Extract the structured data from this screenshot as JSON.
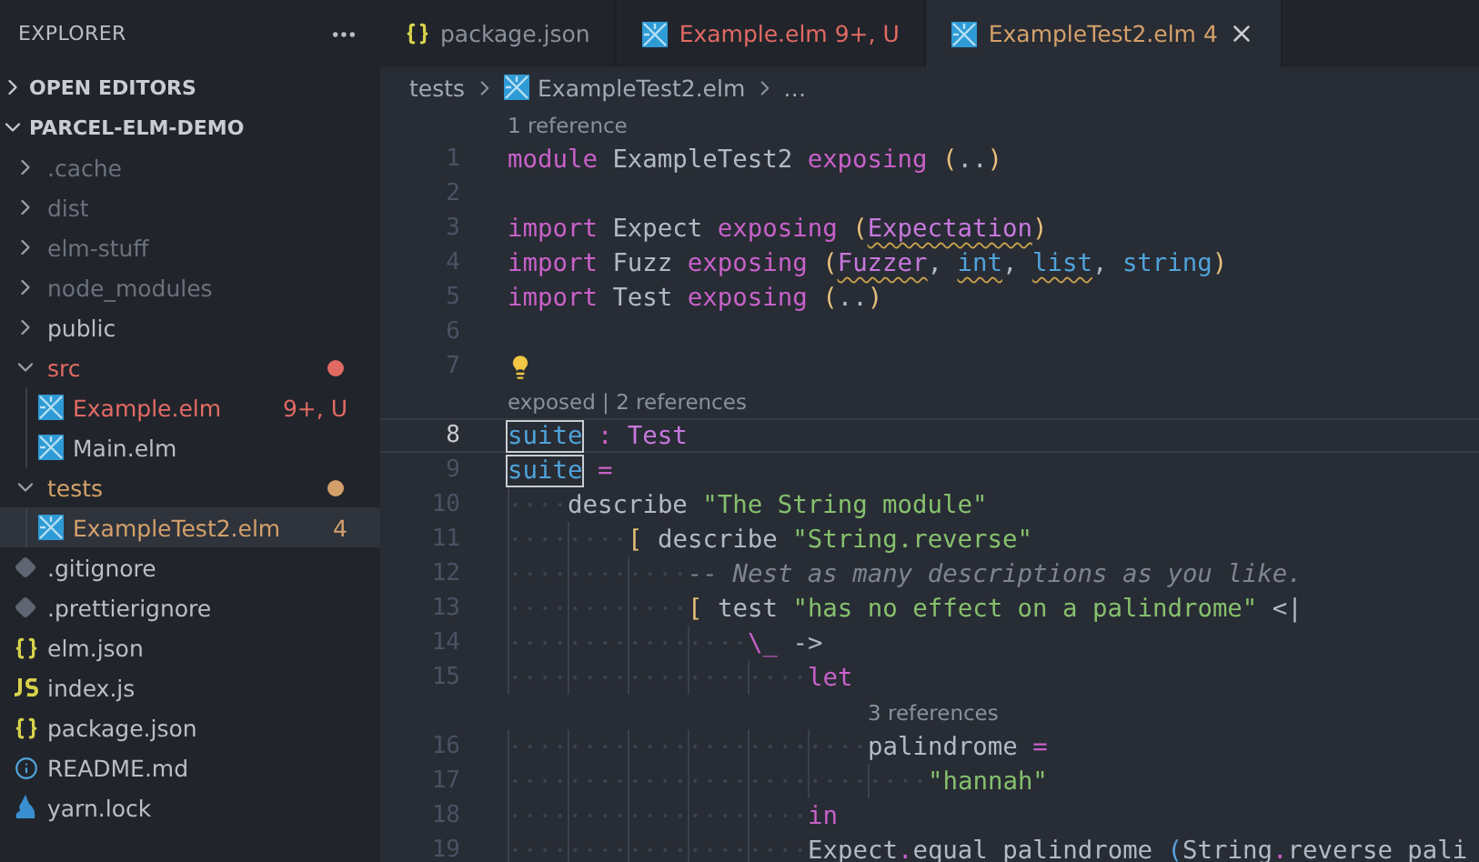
{
  "explorer": {
    "title": "EXPLORER",
    "sections": [
      {
        "title": "OPEN EDITORS",
        "expanded": false
      },
      {
        "title": "PARCEL-ELM-DEMO",
        "expanded": true,
        "children": [
          {
            "name": ".cache",
            "kind": "folder",
            "expanded": false,
            "color": "#6b717d",
            "selected": false
          },
          {
            "name": "dist",
            "kind": "folder",
            "expanded": false,
            "color": "#6b717d",
            "selected": false
          },
          {
            "name": "elm-stuff",
            "kind": "folder",
            "expanded": false,
            "color": "#6b717d",
            "selected": false
          },
          {
            "name": "node_modules",
            "kind": "folder",
            "expanded": false,
            "color": "#6b717d",
            "selected": false
          },
          {
            "name": "public",
            "kind": "folder",
            "expanded": false,
            "color": "#b9bec7",
            "selected": false
          },
          {
            "name": "src",
            "kind": "folder",
            "expanded": true,
            "modified": true,
            "color": "#e26a64",
            "selected": false,
            "children": [
              {
                "name": "Example.elm",
                "kind": "elm",
                "color": "#e26a64",
                "badge": "9+, U",
                "selected": false
              },
              {
                "name": "Main.elm",
                "kind": "elm",
                "color": "#b9bec7",
                "selected": false
              }
            ]
          },
          {
            "name": "tests",
            "kind": "folder",
            "expanded": true,
            "modified": true,
            "color": "#d4a06a",
            "selected": false,
            "children": [
              {
                "name": "ExampleTest2.elm",
                "kind": "elm",
                "color": "#d4a06a",
                "badge": "4",
                "selected": true
              }
            ]
          },
          {
            "name": ".gitignore",
            "kind": "ignore",
            "color": "#b9bec7",
            "selected": false
          },
          {
            "name": ".prettierignore",
            "kind": "ignore",
            "color": "#b9bec7",
            "selected": false
          },
          {
            "name": "elm.json",
            "kind": "json",
            "color": "#b9bec7",
            "selected": false
          },
          {
            "name": "index.js",
            "kind": "js",
            "color": "#b9bec7",
            "selected": false
          },
          {
            "name": "package.json",
            "kind": "json",
            "color": "#b9bec7",
            "selected": false
          },
          {
            "name": "README.md",
            "kind": "info",
            "color": "#b9bec7",
            "selected": false
          },
          {
            "name": "yarn.lock",
            "kind": "yarn",
            "color": "#b9bec7",
            "selected": false
          }
        ]
      }
    ]
  },
  "tabs": [
    {
      "label": "package.json",
      "kind": "json",
      "color": "#8b919c",
      "selected": false
    },
    {
      "label": "Example.elm",
      "kind": "elm",
      "color": "#e26a64",
      "badge": "9+, U",
      "selected": false
    },
    {
      "label": "ExampleTest2.elm",
      "kind": "elm",
      "color": "#d4a06a",
      "badge": "4",
      "selected": true
    }
  ],
  "breadcrumbs": [
    {
      "label": "tests",
      "kind": "folder"
    },
    {
      "label": "ExampleTest2.elm",
      "kind": "elm"
    },
    {
      "label": "…",
      "kind": "more"
    }
  ],
  "code": [
    {
      "kind": "codelens",
      "text": "1 reference"
    },
    {
      "kind": "line",
      "number": "1",
      "current": false,
      "tokens": [
        {
          "kind": "keyword",
          "text": "module"
        },
        {
          "kind": "plain",
          "text": " ExampleTest2 "
        },
        {
          "kind": "keyword",
          "text": "exposing"
        },
        {
          "kind": "paren",
          "text": " ("
        },
        {
          "kind": "plain",
          "text": ".."
        },
        {
          "kind": "paren",
          "text": ")"
        }
      ]
    },
    {
      "kind": "line",
      "number": "2",
      "current": false
    },
    {
      "kind": "line",
      "number": "3",
      "current": false,
      "tokens": [
        {
          "kind": "keyword",
          "text": "import"
        },
        {
          "kind": "plain",
          "text": " Expect "
        },
        {
          "kind": "keyword",
          "text": "exposing"
        },
        {
          "kind": "paren",
          "text": " ("
        },
        {
          "kind": "type",
          "text": "Expectation",
          "warning": true
        },
        {
          "kind": "paren",
          "text": ")"
        }
      ]
    },
    {
      "kind": "line",
      "number": "4",
      "current": false,
      "tokens": [
        {
          "kind": "keyword",
          "text": "import"
        },
        {
          "kind": "plain",
          "text": " Fuzz "
        },
        {
          "kind": "keyword",
          "text": "exposing"
        },
        {
          "kind": "paren",
          "text": " ("
        },
        {
          "kind": "type",
          "text": "Fuzzer",
          "warning": true
        },
        {
          "kind": "plain",
          "text": ", "
        },
        {
          "kind": "func",
          "text": "int",
          "warning": true
        },
        {
          "kind": "plain",
          "text": ", "
        },
        {
          "kind": "func",
          "text": "list",
          "warning": true
        },
        {
          "kind": "plain",
          "text": ", "
        },
        {
          "kind": "func",
          "text": "string"
        },
        {
          "kind": "paren",
          "text": ")"
        }
      ]
    },
    {
      "kind": "line",
      "number": "5",
      "current": false,
      "tokens": [
        {
          "kind": "keyword",
          "text": "import"
        },
        {
          "kind": "plain",
          "text": " Test "
        },
        {
          "kind": "keyword",
          "text": "exposing"
        },
        {
          "kind": "paren",
          "text": " ("
        },
        {
          "kind": "plain",
          "text": ".."
        },
        {
          "kind": "paren",
          "text": ")"
        }
      ]
    },
    {
      "kind": "line",
      "number": "6",
      "current": false
    },
    {
      "kind": "line",
      "number": "7",
      "current": false,
      "lightbulb": true
    },
    {
      "kind": "codelens",
      "text": "exposed | 2 references"
    },
    {
      "kind": "line",
      "number": "8",
      "current": true,
      "tokens": [
        {
          "kind": "func",
          "text": "suite",
          "boxed": true
        },
        {
          "kind": "op",
          "text": " :"
        },
        {
          "kind": "type",
          "text": " Test"
        }
      ]
    },
    {
      "kind": "line",
      "number": "9",
      "current": false,
      "tokens": [
        {
          "kind": "func",
          "text": "suite",
          "boxed": true
        },
        {
          "kind": "op",
          "text": " ="
        }
      ],
      "children": [
        {
          "kind": "line",
          "number": "10",
          "current": false,
          "tokens": [
            {
              "kind": "plain",
              "text": "describe "
            },
            {
              "kind": "string",
              "text": "\"The String module\""
            }
          ],
          "children": [
            {
              "kind": "line",
              "number": "11",
              "current": false,
              "tokens": [
                {
                  "kind": "paren",
                  "text": "["
                },
                {
                  "kind": "plain",
                  "text": " describe "
                },
                {
                  "kind": "string",
                  "text": "\"String.reverse\""
                }
              ],
              "children": [
                {
                  "kind": "line",
                  "number": "12",
                  "current": false,
                  "tokens": [
                    {
                      "kind": "comment",
                      "text": "-- Nest as many descriptions as you like."
                    }
                  ]
                },
                {
                  "kind": "line",
                  "number": "13",
                  "current": false,
                  "tokens": [
                    {
                      "kind": "paren",
                      "text": "["
                    },
                    {
                      "kind": "plain",
                      "text": " test "
                    },
                    {
                      "kind": "string",
                      "text": "\"has no effect on a palindrome\""
                    },
                    {
                      "kind": "plain",
                      "text": " <|"
                    }
                  ],
                  "children": [
                    {
                      "kind": "line",
                      "number": "14",
                      "current": false,
                      "tokens": [
                        {
                          "kind": "op",
                          "text": "\\_"
                        },
                        {
                          "kind": "plain",
                          "text": " ->"
                        }
                      ],
                      "children": [
                        {
                          "kind": "line",
                          "number": "15",
                          "current": false,
                          "tokens": [
                            {
                              "kind": "keyword",
                              "text": "let"
                            }
                          ],
                          "children": [
                            {
                              "kind": "codelens",
                              "text": "3 references"
                            },
                            {
                              "kind": "line",
                              "number": "16",
                              "current": false,
                              "tokens": [
                                {
                                  "kind": "plain",
                                  "text": "palindrome "
                                },
                                {
                                  "kind": "op",
                                  "text": "="
                                }
                              ],
                              "children": [
                                {
                                  "kind": "line",
                                  "number": "17",
                                  "current": false,
                                  "tokens": [
                                    {
                                      "kind": "string",
                                      "text": "\"hannah\""
                                    }
                                  ]
                                }
                              ]
                            }
                          ]
                        },
                        {
                          "kind": "line",
                          "number": "18",
                          "current": false,
                          "tokens": [
                            {
                              "kind": "keyword",
                              "text": "in"
                            }
                          ]
                        },
                        {
                          "kind": "line",
                          "number": "19",
                          "current": false,
                          "tokens": [
                            {
                              "kind": "plain",
                              "text": "Expect"
                            },
                            {
                              "kind": "op",
                              "text": "."
                            },
                            {
                              "kind": "plain",
                              "text": "equal palindrome "
                            },
                            {
                              "kind": "paren2",
                              "text": "("
                            },
                            {
                              "kind": "plain",
                              "text": "String"
                            },
                            {
                              "kind": "op",
                              "text": "."
                            },
                            {
                              "kind": "plain",
                              "text": "reverse pali"
                            }
                          ]
                        }
                      ]
                    }
                  ]
                }
              ]
            }
          ]
        }
      ]
    }
  ]
}
